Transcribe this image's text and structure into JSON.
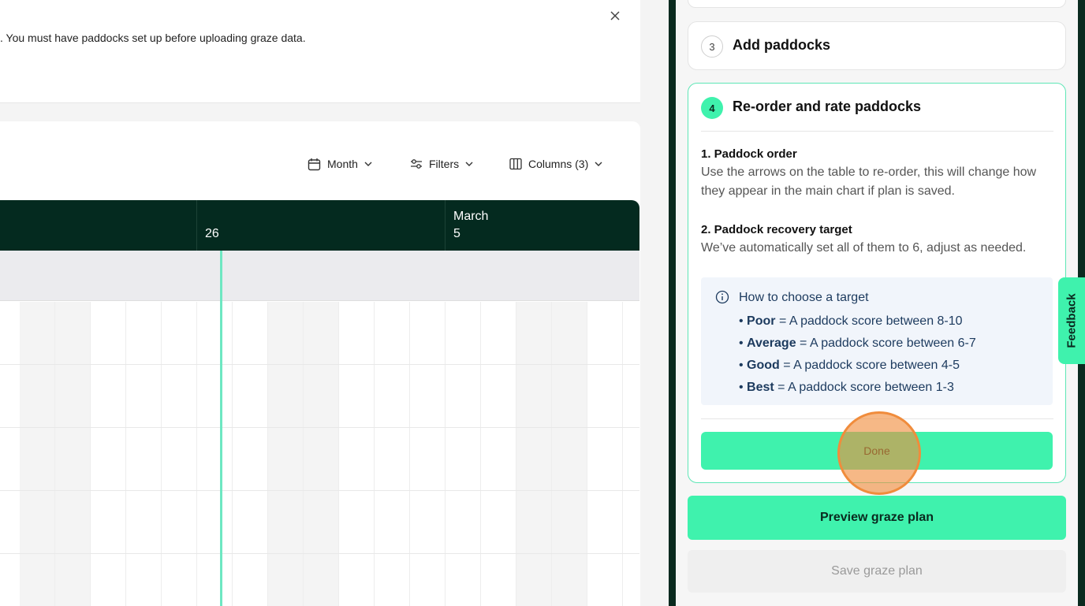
{
  "notice": {
    "text": ". You must have paddocks set up before uploading graze data."
  },
  "toolbar": {
    "month_label": "Month",
    "filters_label": "Filters",
    "columns_label": "Columns (3)"
  },
  "timeline": {
    "headers": [
      {
        "month": "",
        "day": "26"
      },
      {
        "month": "March",
        "day": "5"
      }
    ]
  },
  "panel": {
    "step3": {
      "number": "3",
      "title": "Add paddocks"
    },
    "step4": {
      "number": "4",
      "title": "Re-order and rate paddocks",
      "order_heading": "1. Paddock order",
      "order_text": "Use the arrows on the table to re-order, this will change how they appear in the main chart if plan is saved.",
      "target_heading": "2. Paddock recovery target",
      "target_text": "We’ve automatically set all of them to 6, adjust as needed.",
      "info_title": "How to choose a target",
      "targets": [
        {
          "name": "Poor",
          "desc": " = A paddock score between 8-10"
        },
        {
          "name": "Average",
          "desc": " = A paddock score between 6-7"
        },
        {
          "name": "Good",
          "desc": " = A paddock score between 4-5"
        },
        {
          "name": "Best",
          "desc": " = A paddock score between 1-3"
        }
      ],
      "done_label": "Done"
    },
    "preview_label": "Preview graze plan",
    "save_label": "Save graze plan"
  },
  "feedback_label": "Feedback",
  "colors": {
    "accent": "#3ff2ad",
    "dark": "#042a1f",
    "click_indicator": "#f08c3c"
  }
}
